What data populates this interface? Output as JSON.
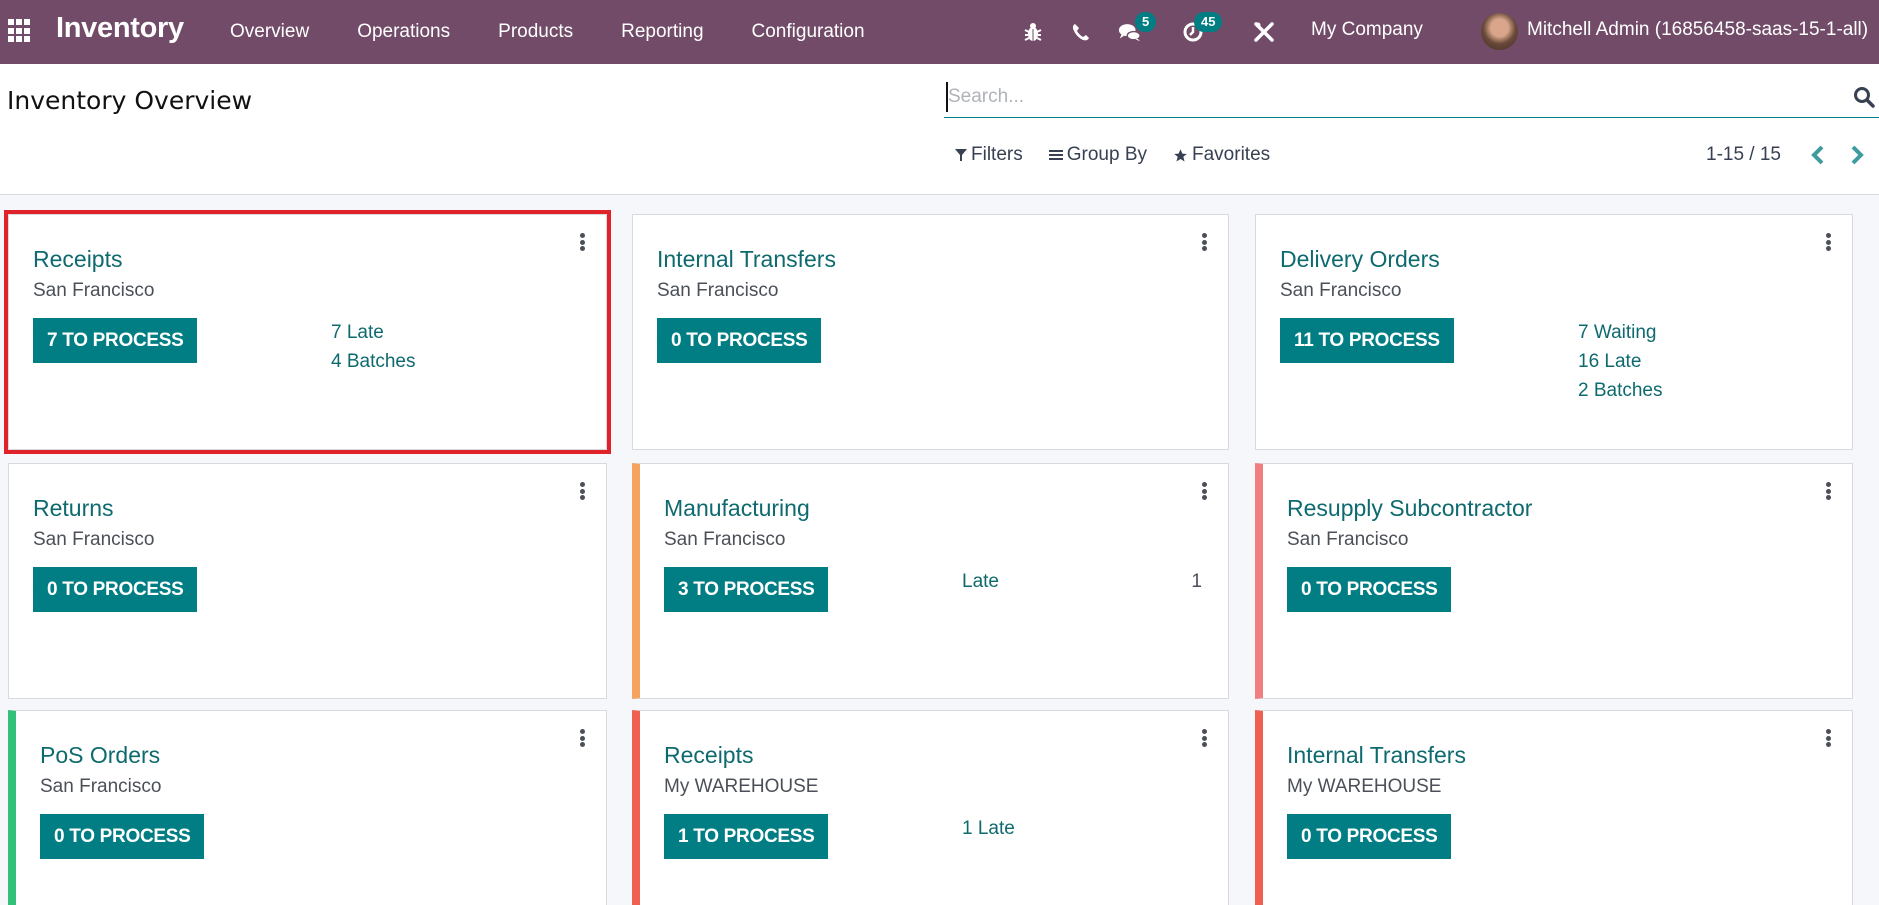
{
  "navbar": {
    "app_name": "Inventory",
    "menu": [
      {
        "label": "Overview"
      },
      {
        "label": "Operations"
      },
      {
        "label": "Products"
      },
      {
        "label": "Reporting"
      },
      {
        "label": "Configuration"
      }
    ],
    "systray": {
      "debug_icon": "bug-icon",
      "phone_icon": "phone-icon",
      "messages_icon": "chat-icon",
      "messages_count": "5",
      "activities_icon": "clock-icon",
      "activities_count": "45",
      "tools_icon": "tools-icon"
    },
    "company": "My Company",
    "user": "Mitchell Admin (16856458-saas-15-1-all)"
  },
  "control_panel": {
    "title": "Inventory Overview",
    "search": {
      "placeholder": "Search...",
      "value": ""
    },
    "filters_label": "Filters",
    "groupby_label": "Group By",
    "favorites_label": "Favorites",
    "pager": "1-15 / 15"
  },
  "colors": {
    "brand": "#714B67",
    "primary": "#017e84",
    "highlight": "#e0222b",
    "orange": "#f4a460",
    "pink": "#f07f7f",
    "green": "#34c07a",
    "red": "#f06050"
  },
  "cards": [
    {
      "title": "Receipts",
      "subtitle": "San Francisco",
      "button": "7 TO PROCESS",
      "stats": [
        {
          "label": "7 Late"
        },
        {
          "label": "4 Batches"
        }
      ],
      "color": "",
      "highlighted": true
    },
    {
      "title": "Internal Transfers",
      "subtitle": "San Francisco",
      "button": "0 TO PROCESS",
      "stats": [],
      "color": ""
    },
    {
      "title": "Delivery Orders",
      "subtitle": "San Francisco",
      "button": "11 TO PROCESS",
      "stats": [
        {
          "label": "7 Waiting"
        },
        {
          "label": "16 Late"
        },
        {
          "label": "2 Batches"
        }
      ],
      "color": ""
    },
    {
      "title": "Returns",
      "subtitle": "San Francisco",
      "button": "0 TO PROCESS",
      "stats": [],
      "color": ""
    },
    {
      "title": "Manufacturing",
      "subtitle": "San Francisco",
      "button": "3 TO PROCESS",
      "stats": [
        {
          "label": "Late",
          "value": "1"
        }
      ],
      "color": "orange"
    },
    {
      "title": "Resupply Subcontractor",
      "subtitle": "San Francisco",
      "button": "0 TO PROCESS",
      "stats": [],
      "color": "pink"
    },
    {
      "title": "PoS Orders",
      "subtitle": "San Francisco",
      "button": "0 TO PROCESS",
      "stats": [],
      "color": "green"
    },
    {
      "title": "Receipts",
      "subtitle": "My WAREHOUSE",
      "button": "1 TO PROCESS",
      "stats": [
        {
          "label": "1 Late"
        }
      ],
      "color": "red"
    },
    {
      "title": "Internal Transfers",
      "subtitle": "My WAREHOUSE",
      "button": "0 TO PROCESS",
      "stats": [],
      "color": "red"
    }
  ]
}
